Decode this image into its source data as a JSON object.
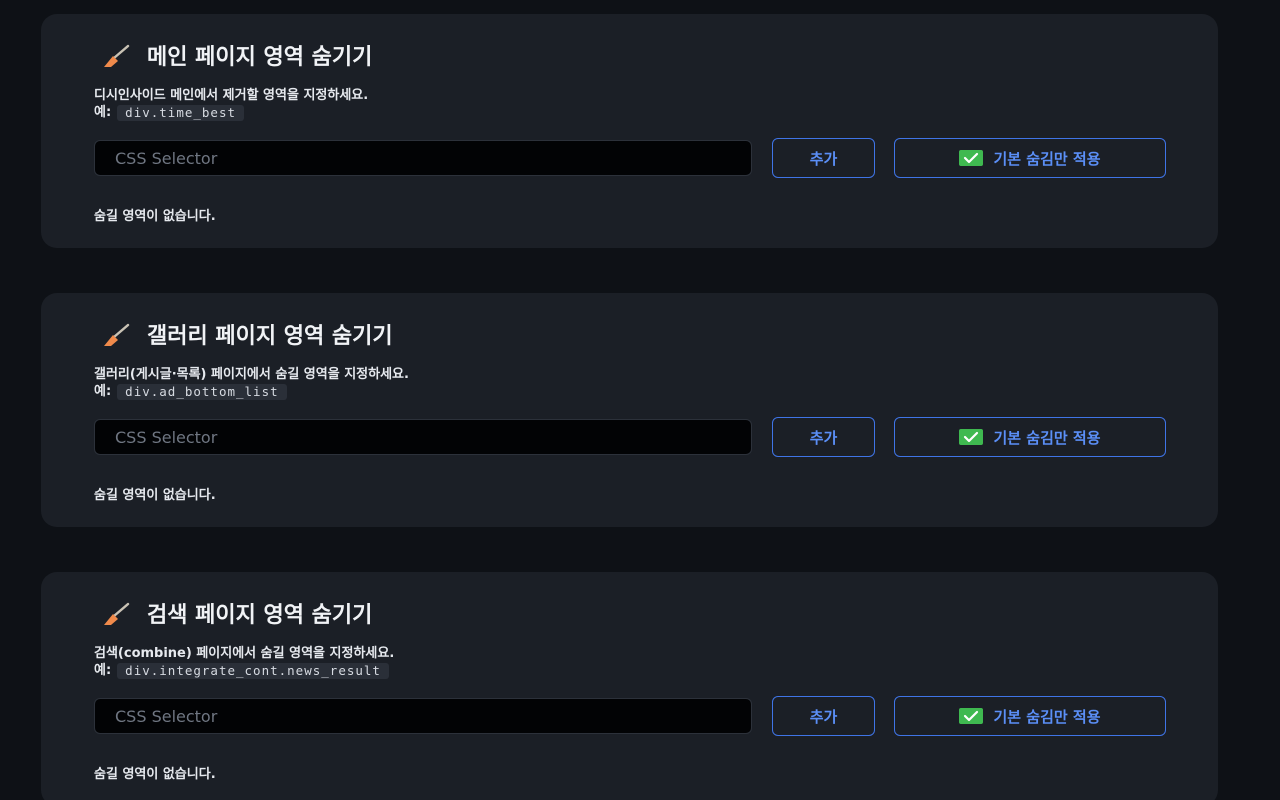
{
  "sections": [
    {
      "title": "메인 페이지 영역 숨기기",
      "description": "디시인사이드 메인에서 제거할 영역을 지정하세요.",
      "example_label": "예:",
      "example_code": "div.time_best",
      "input_placeholder": "CSS Selector",
      "input_value": "",
      "add_label": "추가",
      "default_label": "기본 숨김만 적용",
      "empty_text": "숨길 영역이 없습니다."
    },
    {
      "title": "갤러리 페이지 영역 숨기기",
      "description": "갤러리(게시글·목록) 페이지에서 숨길 영역을 지정하세요.",
      "example_label": "예:",
      "example_code": "div.ad_bottom_list",
      "input_placeholder": "CSS Selector",
      "input_value": "",
      "add_label": "추가",
      "default_label": "기본 숨김만 적용",
      "empty_text": "숨길 영역이 없습니다."
    },
    {
      "title": "검색 페이지 영역 숨기기",
      "description": "검색(combine) 페이지에서 숨길 영역을 지정하세요.",
      "example_label": "예:",
      "example_code": "div.integrate_cont.news_result",
      "input_placeholder": "CSS Selector",
      "input_value": "",
      "add_label": "추가",
      "default_label": "기본 숨김만 적용",
      "empty_text": "숨길 영역이 없습니다."
    }
  ],
  "icons": {
    "title_icon": "broom-icon",
    "button_icon": "check-mark-icon"
  },
  "colors": {
    "background": "#0e1116",
    "card": "#1b1f26",
    "accent": "#5b8ff7",
    "check_green": "#3fb950"
  }
}
